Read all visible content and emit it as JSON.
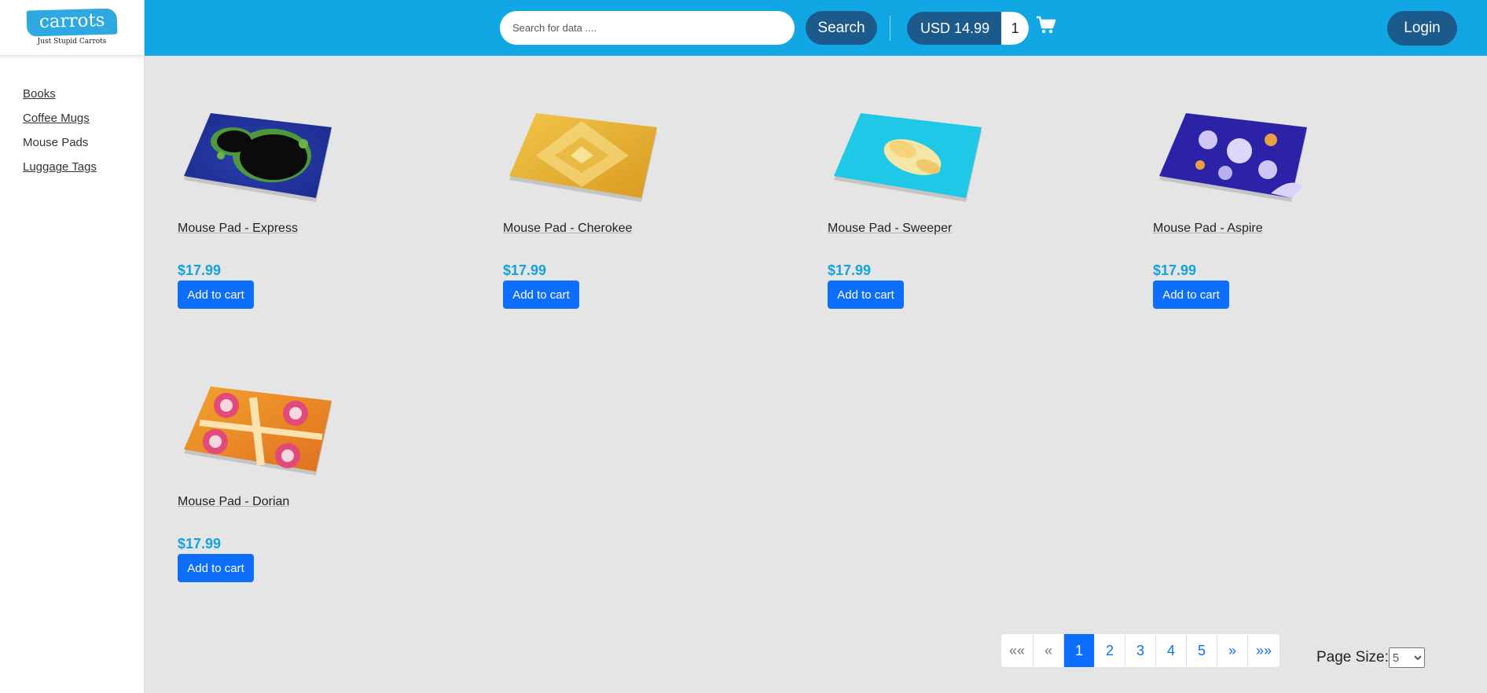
{
  "brand": {
    "name": "carrots",
    "tagline": "Just Stupid Carrots"
  },
  "sidebar": {
    "items": [
      {
        "label": "Books"
      },
      {
        "label": "Coffee Mugs"
      },
      {
        "label": "Mouse Pads",
        "active": true
      },
      {
        "label": "Luggage Tags"
      }
    ]
  },
  "header": {
    "search_placeholder": "Search for data ....",
    "search_label": "Search",
    "balance": "USD 14.99",
    "cart_count": "1",
    "login_label": "Login"
  },
  "products": [
    {
      "title": "Mouse Pad - Express",
      "price": "$17.99",
      "button": "Add to cart"
    },
    {
      "title": "Mouse Pad - Cherokee",
      "price": "$17.99",
      "button": "Add to cart"
    },
    {
      "title": "Mouse Pad - Sweeper",
      "price": "$17.99",
      "button": "Add to cart"
    },
    {
      "title": "Mouse Pad - Aspire",
      "price": "$17.99",
      "button": "Add to cart"
    },
    {
      "title": "Mouse Pad - Dorian",
      "price": "$17.99",
      "button": "Add to cart"
    }
  ],
  "pagination": {
    "first": "««",
    "prev": "«",
    "pages": [
      "1",
      "2",
      "3",
      "4",
      "5"
    ],
    "current": "1",
    "next": "»",
    "last": "»»"
  },
  "page_size": {
    "label": "Page Size:",
    "value": "5",
    "options": [
      "5"
    ]
  },
  "colors": {
    "header": "#10a7e4",
    "accent_dark": "#1d5a8c",
    "price": "#14a3df",
    "button": "#0d6efd"
  },
  "icons": {
    "cart": "shopping-cart-icon"
  }
}
